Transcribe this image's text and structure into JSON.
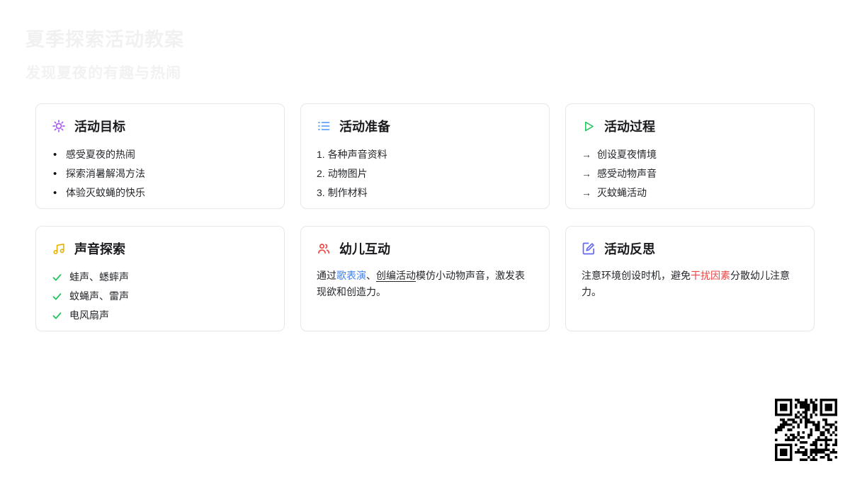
{
  "header": {
    "title": "夏季探索活动教案",
    "subtitle": "发现夏夜的有趣与热闹"
  },
  "cards": [
    {
      "title": "活动目标",
      "icon": "sun-icon",
      "icon_color": "#a855f7",
      "items": [
        {
          "marker": "•",
          "text": "感受夏夜的热闹"
        },
        {
          "marker": "•",
          "text": "探索消暑解渴方法"
        },
        {
          "marker": "•",
          "text": "体验灭蚊蝇的快乐"
        }
      ]
    },
    {
      "title": "活动准备",
      "icon": "ordered-list-icon",
      "icon_color": "#60a5fa",
      "items": [
        {
          "marker": "1.",
          "text": "各种声音资料"
        },
        {
          "marker": "2.",
          "text": "动物图片"
        },
        {
          "marker": "3.",
          "text": "制作材料"
        }
      ]
    },
    {
      "title": "活动过程",
      "icon": "play-icon",
      "icon_color": "#22c55e",
      "items": [
        {
          "marker": "→",
          "text": "创设夏夜情境"
        },
        {
          "marker": "→",
          "text": "感受动物声音"
        },
        {
          "marker": "→",
          "text": "灭蚊蝇活动"
        }
      ]
    },
    {
      "title": "声音探索",
      "icon": "music-note-icon",
      "icon_color": "#eab308",
      "check_color": "#22c55e",
      "items": [
        {
          "text": "蛙声、蟋蟀声"
        },
        {
          "text": "蚊蝇声、雷声"
        },
        {
          "text": "电风扇声"
        }
      ]
    },
    {
      "title": "幼儿互动",
      "icon": "users-icon",
      "icon_color": "#ef4444",
      "paragraph": [
        {
          "text": "通过"
        },
        {
          "text": "歌表演",
          "style": "link"
        },
        {
          "text": "、"
        },
        {
          "text": "创编活动",
          "style": "underline"
        },
        {
          "text": "模仿小动物声音，激发表现欲和创造力。"
        }
      ]
    },
    {
      "title": "活动反思",
      "icon": "edit-icon",
      "icon_color": "#6366f1",
      "paragraph": [
        {
          "text": "注意环境创设时机，避免"
        },
        {
          "text": "干扰因素",
          "style": "red"
        },
        {
          "text": "分散幼儿注意力。"
        }
      ]
    }
  ],
  "colors": {
    "link_blue": "#3b82f6",
    "alert_red": "#ef4444",
    "check_green": "#22c55e",
    "card_border": "#e7e7ec",
    "faint_header": "#f1f1f1"
  },
  "qr": {
    "name": "qr-code"
  }
}
